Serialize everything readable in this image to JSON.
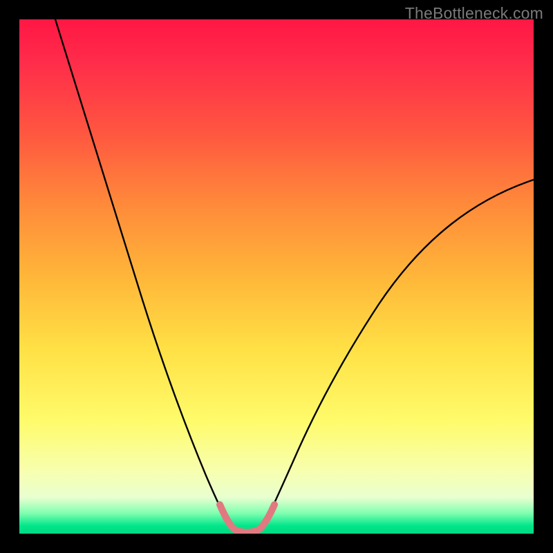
{
  "watermark": "TheBottleneck.com",
  "chart_data": {
    "type": "line",
    "title": "",
    "xlabel": "",
    "ylabel": "",
    "xlim": [
      0,
      100
    ],
    "ylim": [
      0,
      100
    ],
    "series": [
      {
        "name": "left-curve",
        "x": [
          7,
          10,
          13,
          16,
          19,
          22,
          25,
          28,
          31,
          33,
          35,
          37,
          38.5,
          40
        ],
        "values": [
          100,
          88,
          76,
          65,
          55,
          45,
          36,
          27,
          19,
          13,
          8.5,
          5,
          2.5,
          1
        ]
      },
      {
        "name": "right-curve",
        "x": [
          46,
          48,
          50,
          53,
          56,
          60,
          65,
          70,
          76,
          83,
          90,
          97,
          100
        ],
        "values": [
          1,
          2.5,
          5,
          9,
          14,
          20,
          27,
          34,
          42,
          50,
          57,
          64,
          67
        ]
      },
      {
        "name": "floor-band",
        "x": [
          38.5,
          40,
          41,
          42,
          43,
          44,
          45,
          46,
          47
        ],
        "values": [
          3.5,
          1,
          0.5,
          0.3,
          0.3,
          0.3,
          0.5,
          1,
          3.5
        ]
      }
    ],
    "annotations": {
      "bottom_highlight_color": "#e07a80",
      "bottom_highlight_width": 10
    }
  }
}
